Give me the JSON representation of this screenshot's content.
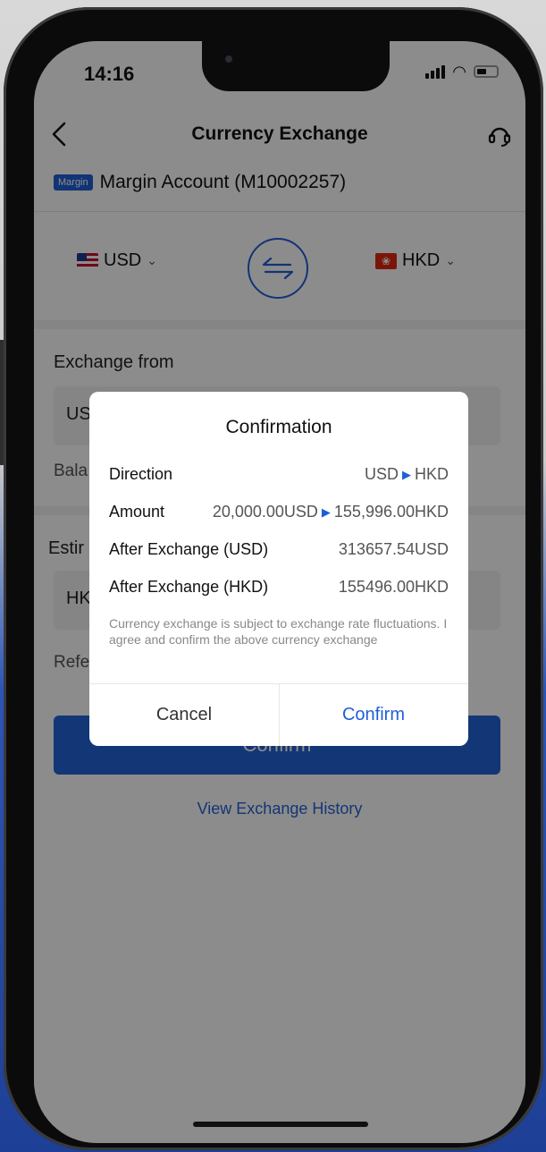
{
  "status_bar": {
    "time": "14:16"
  },
  "nav": {
    "title": "Currency Exchange"
  },
  "account": {
    "badge": "Margin",
    "name": "Margin Account (M10002257)"
  },
  "currency": {
    "from_code": "USD",
    "to_code": "HKD"
  },
  "form": {
    "exchange_from_label": "Exchange from",
    "from_input_partial": "US",
    "balance_partial": "Bala",
    "estimated_label_partial": "Estir",
    "to_input_partial": "HK",
    "reference_partial": "Refe"
  },
  "main": {
    "confirm_button": "Confirm",
    "history_link": "View Exchange History"
  },
  "dialog": {
    "title": "Confirmation",
    "rows": [
      {
        "label": "Direction",
        "from": "USD",
        "to": "HKD"
      },
      {
        "label": "Amount",
        "from": "20,000.00USD",
        "to": "155,996.00HKD"
      },
      {
        "label": "After Exchange (USD)",
        "value": "313657.54USD"
      },
      {
        "label": "After Exchange (HKD)",
        "value": "155496.00HKD"
      }
    ],
    "note": "Currency exchange is subject to exchange rate fluctuations. I agree and confirm the above currency exchange",
    "cancel": "Cancel",
    "confirm": "Confirm"
  },
  "colors": {
    "accent": "#1f5fd6",
    "primary_button": "#2463d8",
    "overlay": "rgba(0,0,0,0.45)"
  },
  "icons": {
    "back": "chevron-left-icon",
    "support": "headset-icon",
    "swap": "swap-arrows-icon",
    "dropdown": "chevron-down-icon",
    "direction": "triangle-right-icon"
  }
}
